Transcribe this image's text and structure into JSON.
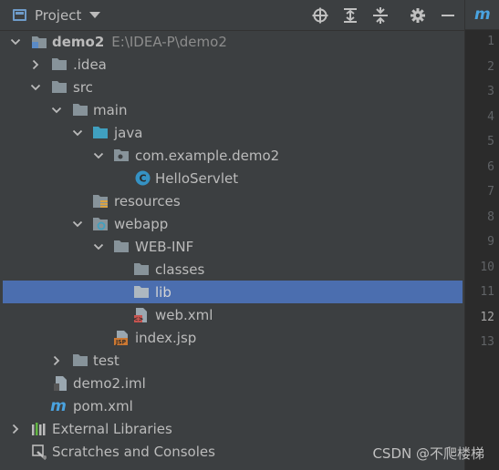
{
  "header": {
    "title": "Project",
    "tools": [
      "locate-icon",
      "expand-all-icon",
      "collapse-all-icon",
      "gear-icon",
      "minimize-icon"
    ]
  },
  "editor": {
    "tab_icon_text": "m",
    "line_numbers": [
      "1",
      "2",
      "3",
      "4",
      "5",
      "6",
      "7",
      "8",
      "9",
      "10",
      "11",
      "12",
      "13"
    ],
    "current_line": "12"
  },
  "tree": {
    "root_label": "demo2",
    "root_path": "E:\\IDEA-P\\demo2",
    "idea": ".idea",
    "src": "src",
    "main": "main",
    "java": "java",
    "package": "com.example.demo2",
    "servlet": "HelloServlet",
    "resources": "resources",
    "webapp": "webapp",
    "webinf": "WEB-INF",
    "classes": "classes",
    "lib": "lib",
    "webxml": "web.xml",
    "indexjsp": "index.jsp",
    "test": "test",
    "iml": "demo2.iml",
    "pom": "pom.xml",
    "ext_libs": "External Libraries",
    "scratches": "Scratches and Consoles",
    "selected": "lib"
  },
  "watermark": "CSDN @不爬楼梯",
  "colors": {
    "background": "#3c3f41",
    "selection": "#4b6eaf",
    "folder": "#87939a",
    "source_folder": "#40a0c0",
    "resource_accent": "#d9a343"
  }
}
